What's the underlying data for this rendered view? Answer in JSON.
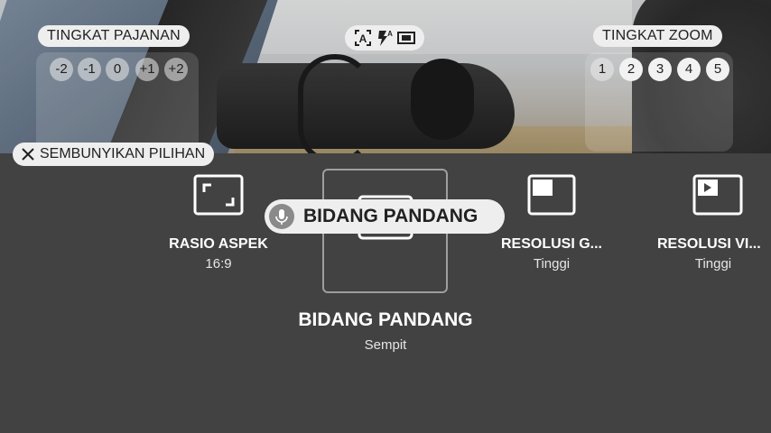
{
  "exposure": {
    "label": "TINGKAT PAJANAN",
    "levels": [
      "-2",
      "-1",
      "0",
      "+1",
      "+2"
    ]
  },
  "zoom": {
    "label": "TINGKAT ZOOM",
    "levels": [
      "1",
      "2",
      "3",
      "4",
      "5"
    ]
  },
  "top_icons": [
    "auto-mode-icon",
    "flash-auto-icon",
    "frame-icon"
  ],
  "hide_options": {
    "label": "SEMBUNYIKAN PILIHAN"
  },
  "options": [
    {
      "title": "RASIO ASPEK",
      "value": "16:9",
      "icon": "aspect-ratio-icon"
    },
    {
      "title": "BIDANG PANDANG",
      "value": "Sempit",
      "icon": "field-of-view-icon"
    },
    {
      "title": "RESOLUSI G...",
      "value": "Tinggi",
      "icon": "photo-resolution-icon"
    },
    {
      "title": "RESOLUSI VI...",
      "value": "Tinggi",
      "icon": "video-resolution-icon"
    }
  ],
  "voice_hint": {
    "label": "BIDANG PANDANG"
  },
  "colors": {
    "background": "#424242",
    "pill": "#eeeeee",
    "text_dark": "#212121"
  }
}
